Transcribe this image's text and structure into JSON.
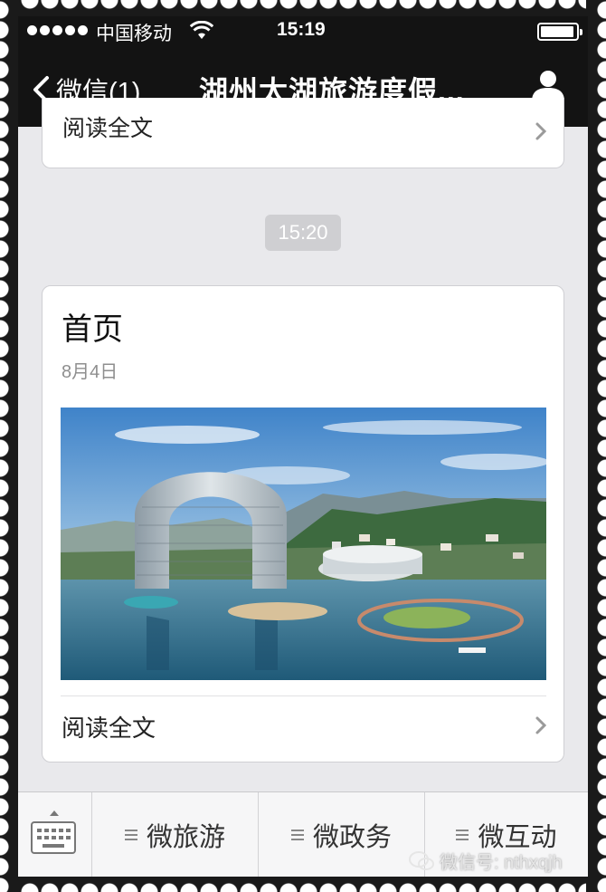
{
  "status_bar": {
    "carrier": "中国移动",
    "time": "15:19"
  },
  "nav": {
    "back_label": "微信(1)",
    "title": "湖州太湖旅游度假..."
  },
  "chat": {
    "prev_card": {
      "read_more": "阅读全文"
    },
    "timestamp": "15:20",
    "post": {
      "title": "首页",
      "date": "8月4日",
      "image_icon": "resort-photo",
      "read_more": "阅读全文"
    }
  },
  "menu": {
    "items": [
      {
        "label": "微旅游"
      },
      {
        "label": "微政务"
      },
      {
        "label": "微互动"
      }
    ]
  },
  "watermark": "微信号: nthxqjh",
  "colors": {
    "nav_bg": "#131313",
    "chat_bg": "#e9e9ec",
    "time_pill": "#cfcfd2"
  }
}
